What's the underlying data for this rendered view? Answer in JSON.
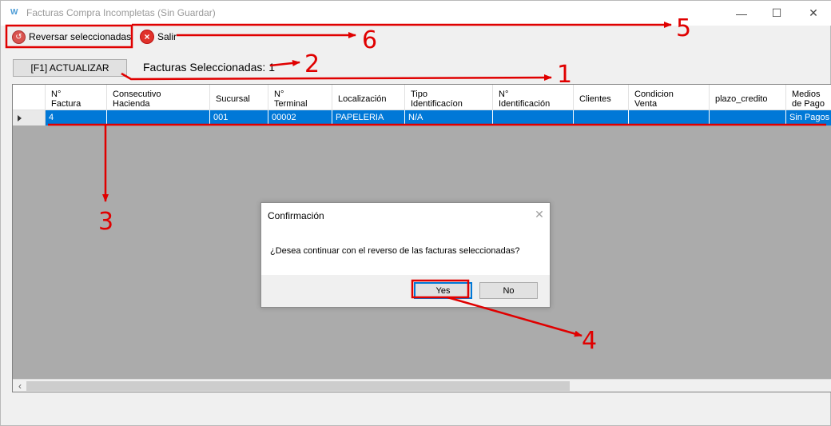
{
  "window": {
    "title": "Facturas Compra Incompletas (Sin Guardar)",
    "minimize_symbol": "—",
    "maximize_symbol": "☐",
    "close_symbol": "✕"
  },
  "toolbar": {
    "reversar_label": "Reversar seleccionadas",
    "salir_label": "Salir"
  },
  "actualizar_label": "[F1] ACTUALIZAR",
  "seleccionadas_label": "Facturas Seleccionadas: 1",
  "grid": {
    "columns": [
      "N°\nFactura",
      "Consecutivo\nHacienda",
      "Sucursal",
      "N°\nTerminal",
      "Localización",
      "Tipo\nIdentificacíon",
      "N°\nIdentificación",
      "Clientes",
      "Condicion\nVenta",
      "plazo_credito",
      "Medios\nde Pago"
    ],
    "rows": [
      [
        "4",
        "",
        "001",
        "00002",
        "PAPELERIA",
        "N/A",
        "",
        "",
        "",
        "",
        "Sin Pagos"
      ]
    ]
  },
  "dialog": {
    "title": "Confirmación",
    "message": "¿Desea continuar con el reverso de las facturas seleccionadas?",
    "yes_label": "Yes",
    "no_label": "No",
    "close_symbol": "✕"
  },
  "annotations": {
    "color": "#e00000",
    "labels": [
      "1",
      "2",
      "3",
      "4",
      "5",
      "6"
    ]
  }
}
